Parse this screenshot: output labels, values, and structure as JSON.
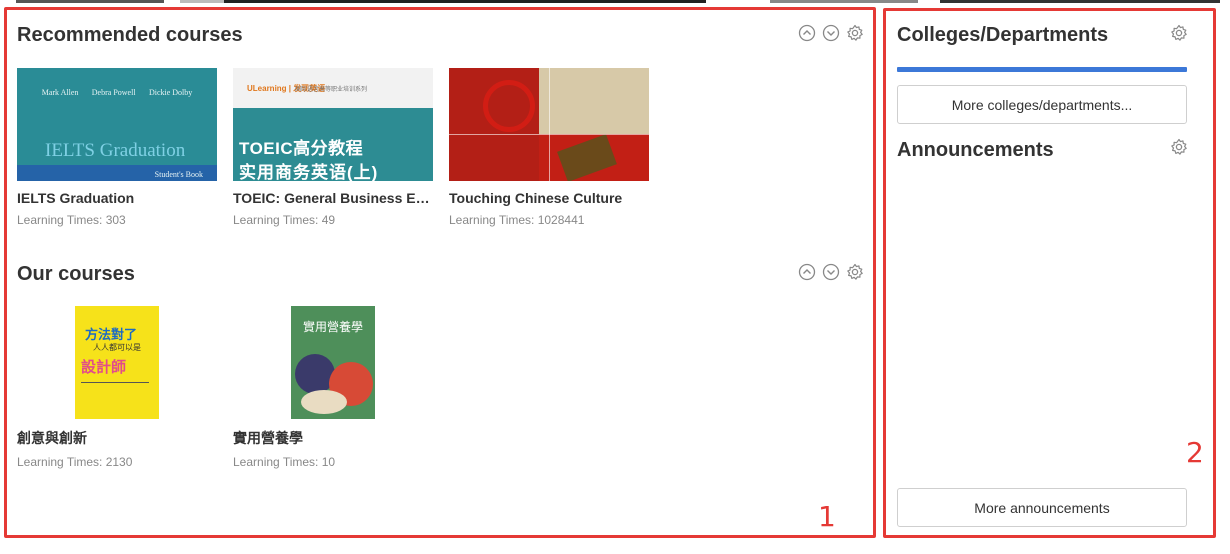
{
  "recommended": {
    "title": "Recommended courses",
    "courses": [
      {
        "name": "IELTS Graduation",
        "times": "Learning Times: 303",
        "cover": {
          "authors": [
            "Mark Allen",
            "Debra Powell",
            "Dickie Dolby"
          ],
          "title": "IELTS Graduation",
          "subtitle": "Student's Book"
        }
      },
      {
        "name": "TOEIC: General Business English",
        "times": "Learning Times: 49",
        "cover": {
          "brand": "ULearning | 发现英语",
          "series": "国际语言高等职业培训系列",
          "line1": "TOEIC高分教程",
          "line2": "实用商务英语(上)"
        }
      },
      {
        "name": "Touching Chinese Culture",
        "times": "Learning Times: 1028441"
      }
    ]
  },
  "our_courses": {
    "title": "Our courses",
    "courses": [
      {
        "name": "創意與創新",
        "times": "Learning Times: 2130",
        "cover": {
          "line1": "方法對了",
          "line2": "人人都可以是",
          "line3": "設計師"
        }
      },
      {
        "name": "實用營養學",
        "times": "Learning Times: 10",
        "cover": {
          "title": "實用營養學"
        }
      }
    ]
  },
  "sidebar": {
    "colleges_title": "Colleges/Departments",
    "more_colleges": "More colleges/departments...",
    "announcements_title": "Announcements",
    "more_announcements": "More announcements"
  },
  "annotations": {
    "label_1": "1",
    "label_2": "2"
  },
  "colors": {
    "highlight": "#e53935",
    "accent_bar": "#3c78d8"
  },
  "icons": [
    "collapse-up-icon",
    "expand-down-icon",
    "gear-icon"
  ]
}
